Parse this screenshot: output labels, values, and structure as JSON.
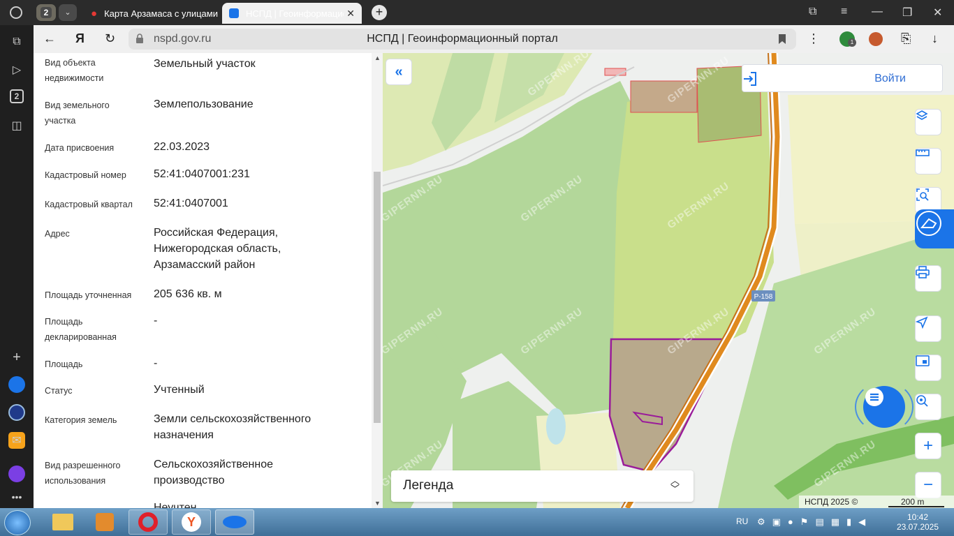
{
  "browser": {
    "tab_count": "2",
    "tabs": [
      {
        "title": "Карта Арзамаса с улицами"
      },
      {
        "title": "НСПД | Геоинформационный портал"
      }
    ],
    "url": "nspd.gov.ru",
    "page_title": "НСПД | Геоинформационный портал",
    "sidebar_badge": "2",
    "shield_badge": "1"
  },
  "info": {
    "rows": [
      {
        "label": "Вид объекта недвижимости",
        "value": "Земельный участок"
      },
      {
        "label": "Вид земельного участка",
        "value": "Землепользование"
      },
      {
        "label": "Дата присвоения",
        "value": "22.03.2023"
      },
      {
        "label": "Кадастровый номер",
        "value": "52:41:0407001:231"
      },
      {
        "label": "Кадастровый квартал",
        "value": "52:41:0407001"
      },
      {
        "label": "Адрес",
        "value": "Российская Федерация, Нижегородская область, Арзамасский район"
      },
      {
        "label": "Площадь уточненная",
        "value": "205 636 кв. м"
      },
      {
        "label": "Площадь декларированная",
        "value": "-"
      },
      {
        "label": "Площадь",
        "value": "-"
      },
      {
        "label": "Статус",
        "value": "Учтенный"
      },
      {
        "label": "Категория земель",
        "value": "Земли сельскохозяйственного назначения"
      },
      {
        "label": "Вид разрешенного использования",
        "value": "Сельскохозяйственное производство"
      },
      {
        "label": "",
        "value": "Неучтен"
      }
    ]
  },
  "map": {
    "login_label": "Войти",
    "legend_label": "Легенда",
    "attribution": "НСПД 2025 ©",
    "scale_label": "200 m",
    "road_label": "Р-158",
    "watermark": "GIPERNN.RU",
    "colors": {
      "forest": "#b3d79a",
      "field": "#dde9b3",
      "parcel_selected": "#9a1c9a",
      "parcel_fill": "#b8a98c",
      "road": "#e08a1e",
      "accent": "#1b74e8"
    }
  },
  "taskbar": {
    "lang": "RU",
    "time": "10:42",
    "date": "23.07.2025"
  }
}
